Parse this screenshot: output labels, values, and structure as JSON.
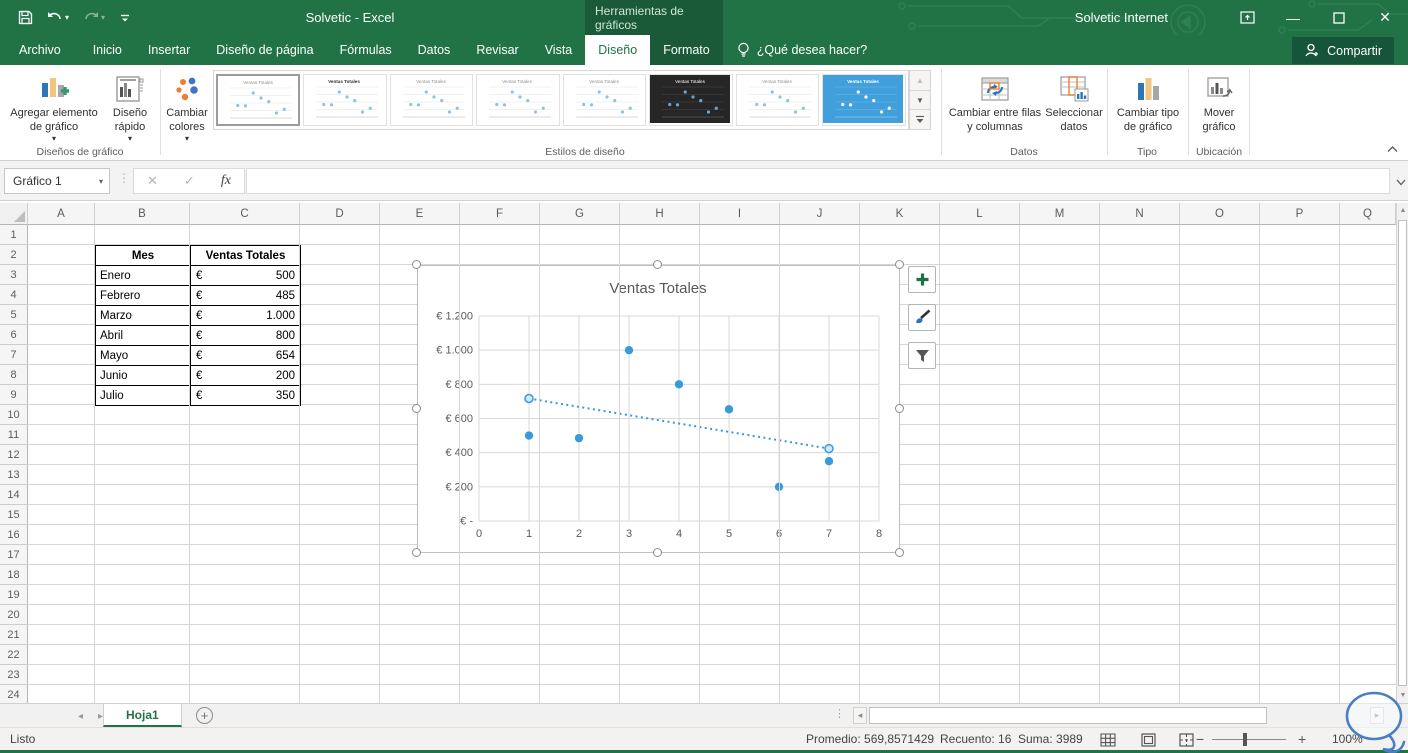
{
  "titlebar": {
    "app_title": "Solvetic  -  Excel",
    "contextual_header": "Herramientas de gráficos",
    "account_name": "Solvetic Internet"
  },
  "tabs": {
    "items": [
      {
        "label": "Archivo",
        "id": "archivo",
        "first": true
      },
      {
        "label": "Inicio",
        "id": "inicio"
      },
      {
        "label": "Insertar",
        "id": "insertar"
      },
      {
        "label": "Diseño de página",
        "id": "diseno-de-pagina"
      },
      {
        "label": "Fórmulas",
        "id": "formulas"
      },
      {
        "label": "Datos",
        "id": "datos"
      },
      {
        "label": "Revisar",
        "id": "revisar"
      },
      {
        "label": "Vista",
        "id": "vista"
      },
      {
        "label": "Diseño",
        "id": "diseno",
        "active": true,
        "contextual": true
      },
      {
        "label": "Formato",
        "id": "formato",
        "contextual": true
      }
    ],
    "tell_me": "¿Qué desea hacer?",
    "share_label": "Compartir"
  },
  "ribbon": {
    "buttons": {
      "add_element": "Agregar elemento de gráfico",
      "quick_layout": "Diseño rápido",
      "change_colors": "Cambiar colores",
      "switch_rows_columns": "Cambiar entre filas y columnas",
      "select_data": "Seleccionar datos",
      "change_type": "Cambiar tipo de gráfico",
      "move_chart": "Mover gráfico"
    },
    "group_labels": {
      "layouts": "Diseños de gráfico",
      "styles": "Estilos de diseño",
      "data": "Datos",
      "type": "Tipo",
      "location": "Ubicación"
    },
    "gallery_styles": [
      "selected",
      "boldtitle",
      "plain",
      "plain",
      "plain",
      "dark",
      "plain",
      "blue"
    ]
  },
  "formula_bar": {
    "name_box": "Gráfico 1",
    "fx_label": "fx",
    "formula": ""
  },
  "grid": {
    "columns": [
      "A",
      "B",
      "C",
      "D",
      "E",
      "F",
      "G",
      "H",
      "I",
      "J",
      "K",
      "L",
      "M",
      "N",
      "O",
      "P",
      "Q"
    ],
    "row_count": 24
  },
  "sheet_table": {
    "headers": [
      "Mes",
      "Ventas Totales"
    ],
    "rows": [
      {
        "mes": "Enero",
        "symbol": "€",
        "value": "500"
      },
      {
        "mes": "Febrero",
        "symbol": "€",
        "value": "485"
      },
      {
        "mes": "Marzo",
        "symbol": "€",
        "value": "1.000"
      },
      {
        "mes": "Abril",
        "symbol": "€",
        "value": "800"
      },
      {
        "mes": "Mayo",
        "symbol": "€",
        "value": "654"
      },
      {
        "mes": "Junio",
        "symbol": "€",
        "value": "200"
      },
      {
        "mes": "Julio",
        "symbol": "€",
        "value": "350"
      }
    ]
  },
  "chart_data": {
    "type": "scatter",
    "title": "Ventas Totales",
    "x": [
      1,
      2,
      3,
      4,
      5,
      6,
      7
    ],
    "y": [
      500,
      485,
      1000,
      800,
      654,
      200,
      350
    ],
    "trendline": {
      "type": "linear",
      "style": "dotted",
      "x": [
        1,
        7
      ],
      "y": [
        717,
        424
      ]
    },
    "xlim": [
      0,
      8
    ],
    "ylim": [
      0,
      1200
    ],
    "x_tick_labels": [
      "0",
      "1",
      "2",
      "3",
      "4",
      "5",
      "6",
      "7",
      "8"
    ],
    "y_tick_labels_top_down": [
      "€ 1.200",
      "€ 1.000",
      "€ 800",
      "€ 600",
      "€ 400",
      "€ 200",
      "€ -"
    ],
    "grid": true,
    "legend": "none",
    "marker_color": "#3a9ad9",
    "text_color": "#595959"
  },
  "sheet_tabs": {
    "active": "Hoja1"
  },
  "status_bar": {
    "mode": "Listo",
    "average": "Promedio: 569,8571429",
    "count": "Recuento: 16",
    "sum": "Suma: 3989",
    "zoom": "100%"
  },
  "colors": {
    "accent_green": "#217346",
    "contextual_green": "#1a5a38",
    "marker_blue": "#3a9ad9",
    "annotation_blue": "#4a7ec3"
  }
}
